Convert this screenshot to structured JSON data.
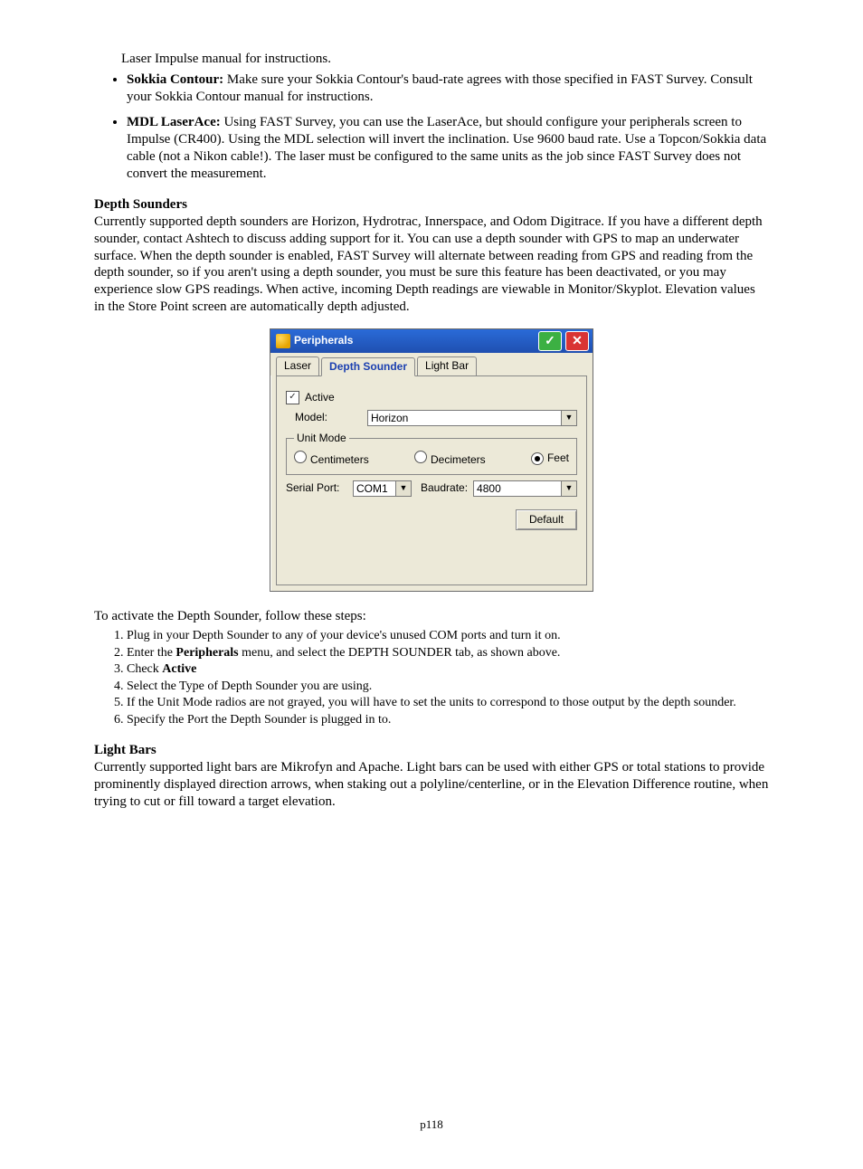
{
  "intro_frag": "Laser Impulse manual for instructions.",
  "bullets": [
    {
      "term": "Sokkia Contour:",
      "rest": " Make sure your Sokkia Contour's baud-rate agrees with those specified in FAST Survey. Consult your Sokkia Contour manual for instructions."
    },
    {
      "term": "MDL LaserAce:",
      "rest": " Using FAST Survey, you can use the LaserAce, but should configure your peripherals screen to Impulse (CR400). Using the MDL selection will invert the inclination.  Use 9600 baud rate.  Use a Topcon/Sokkia data cable (not a Nikon cable!). The laser must be configured to the same units as the job since FAST Survey does not convert the measurement."
    }
  ],
  "depth_h": "Depth Sounders",
  "depth_p": "Currently supported depth sounders are Horizon, Hydrotrac, Innerspace, and Odom Digitrace. If you have a different depth sounder, contact Ashtech to discuss adding support for it. You can use a depth sounder with GPS to map an underwater surface. When the depth sounder is enabled, FAST Survey will alternate between reading from GPS and reading from the depth sounder, so if you aren't using a depth sounder, you must be sure this feature has been deactivated, or you may experience slow GPS readings. When active, incoming Depth readings are viewable in Monitor/Skyplot. Elevation values in the Store Point screen are automatically depth adjusted.",
  "dialog": {
    "title": "Peripherals",
    "tabs": [
      "Laser",
      "Depth Sounder",
      "Light Bar"
    ],
    "active_chk": "Active",
    "model_lbl": "Model:",
    "model_val": "Horizon",
    "unitmode": "Unit Mode",
    "radios": [
      "Centimeters",
      "Decimeters",
      "Feet"
    ],
    "serial_lbl": "Serial Port:",
    "serial_val": "COM1",
    "baud_lbl": "Baudrate:",
    "baud_val": "4800",
    "default_btn": "Default"
  },
  "steps_intro": "To activate the Depth Sounder, follow these steps:",
  "steps": [
    "Plug in your Depth Sounder to any of your device's unused COM ports and turn it on.",
    "Enter the |Peripherals| menu, and select the DEPTH SOUNDER tab, as shown above.",
    "Check |Active|",
    "Select the Type of Depth Sounder you are using.",
    "If the Unit Mode radios are not grayed, you will have to set the units to correspond to those output by the depth sounder.",
    "Specify the Port the Depth Sounder is plugged in to."
  ],
  "light_h": "Light Bars",
  "light_p": "Currently supported light bars are Mikrofyn and Apache. Light bars can be used with either GPS or total stations to provide prominently displayed direction arrows, when staking out a polyline/centerline, or in the Elevation Difference routine, when trying to cut or fill toward a target elevation.",
  "footer": "p118"
}
